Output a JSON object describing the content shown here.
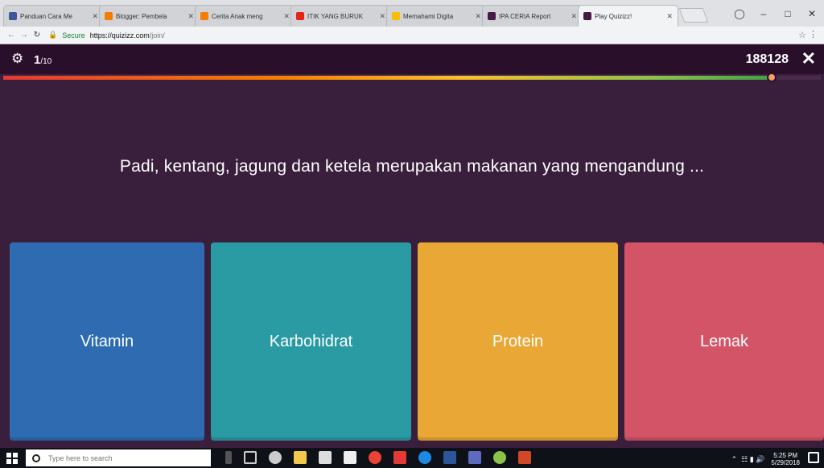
{
  "browser": {
    "tabs": [
      {
        "title": "Panduan Cara Me",
        "favicon": "blog-icon",
        "color": "#3b5998"
      },
      {
        "title": "Blogger: Pembela",
        "favicon": "blogger-icon",
        "color": "#f57c00"
      },
      {
        "title": "Cerita Anak meng",
        "favicon": "blogger-icon",
        "color": "#f57c00"
      },
      {
        "title": "ITIK YANG BURUK",
        "favicon": "youtube-icon",
        "color": "#e62117"
      },
      {
        "title": "Memahami Digita",
        "favicon": "drive-icon",
        "color": "#fbbc04"
      },
      {
        "title": "IPA CERIA Report",
        "favicon": "quizizz-icon",
        "color": "#461a48"
      },
      {
        "title": "Play Quizizz!",
        "favicon": "quizizz-icon",
        "color": "#461a48",
        "active": true
      }
    ],
    "secure_label": "Secure",
    "url_host": "https://quizizz.com",
    "url_path": "/join/"
  },
  "quiz": {
    "question_current": "1",
    "question_total": "/10",
    "score": "188128",
    "timer_remaining_fraction": 0.94,
    "question": "Padi, kentang, jagung dan ketela merupakan makanan yang mengandung ...",
    "answers": [
      {
        "label": "Vitamin",
        "color": "#2e6bb0"
      },
      {
        "label": "Karbohidrat",
        "color": "#2a9aa3"
      },
      {
        "label": "Protein",
        "color": "#e9a735"
      },
      {
        "label": "Lemak",
        "color": "#d35467"
      }
    ]
  },
  "taskbar": {
    "search_placeholder": "Type here to search",
    "time": "5:25 PM",
    "date": "5/29/2018"
  }
}
